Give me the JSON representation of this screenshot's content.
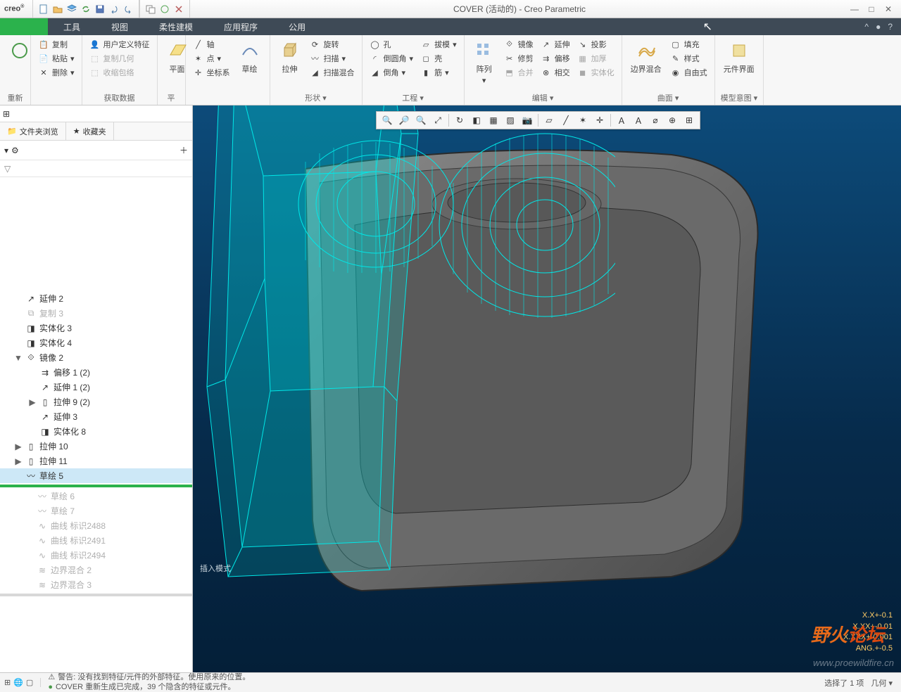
{
  "app": {
    "logo": "creo",
    "title": "COVER (活动的) - Creo Parametric"
  },
  "ribbon_tabs": [
    "工具",
    "视图",
    "柔性建模",
    "应用程序",
    "公用"
  ],
  "ribbon": {
    "clipboard": {
      "copy": "复制",
      "paste": "粘贴",
      "delete": "删除",
      "label": "重新"
    },
    "user": {
      "udf": "用户定义特征",
      "copygeom": "复制几何",
      "shrinkwrap": "收缩包络",
      "label": "获取数据"
    },
    "plane": {
      "plane": "平面",
      "label": "平"
    },
    "datum": {
      "axis": "轴",
      "point": "点",
      "csys": "坐标系",
      "sketch": "草绘"
    },
    "shape": {
      "extrude": "拉伸",
      "revolve": "旋转",
      "sweep": "扫描",
      "blend": "扫描混合",
      "label": "形状"
    },
    "eng": {
      "hole": "孔",
      "round": "倒圆角",
      "chamfer": "倒角",
      "draft": "拔模",
      "shell": "壳",
      "rib": "筋",
      "label": "工程"
    },
    "edit": {
      "pattern": "阵列",
      "mirror": "镜像",
      "trim": "修剪",
      "merge": "合并",
      "extend": "延伸",
      "offset": "偏移",
      "intersect": "相交",
      "project": "投影",
      "thicken": "加厚",
      "solidify": "实体化",
      "label": "编辑"
    },
    "surf": {
      "boundary": "边界混合",
      "fill": "填充",
      "style": "样式",
      "freestyle": "自由式",
      "label": "曲面"
    },
    "model": {
      "comp": "元件界面",
      "label": "模型意图"
    }
  },
  "side": {
    "tab_browser": "文件夹浏览",
    "tab_fav": "收藏夹",
    "items": [
      {
        "d": 0,
        "exp": "",
        "ic": "ext",
        "t": "延伸 2"
      },
      {
        "d": 0,
        "exp": "",
        "ic": "copy",
        "t": "复制 3",
        "dim": true
      },
      {
        "d": 0,
        "exp": "",
        "ic": "sol",
        "t": "实体化 3"
      },
      {
        "d": 0,
        "exp": "",
        "ic": "sol",
        "t": "实体化 4"
      },
      {
        "d": 0,
        "exp": "▼",
        "ic": "mir",
        "t": "镜像 2"
      },
      {
        "d": 1,
        "exp": "",
        "ic": "off",
        "t": "偏移 1 (2)"
      },
      {
        "d": 1,
        "exp": "",
        "ic": "ext",
        "t": "延伸 1 (2)"
      },
      {
        "d": 1,
        "exp": "▶",
        "ic": "extr",
        "t": "拉伸 9 (2)"
      },
      {
        "d": 1,
        "exp": "",
        "ic": "ext",
        "t": "延伸 3"
      },
      {
        "d": 1,
        "exp": "",
        "ic": "sol",
        "t": "实体化 8"
      },
      {
        "d": 0,
        "exp": "▶",
        "ic": "extr",
        "t": "拉伸 10"
      },
      {
        "d": 0,
        "exp": "▶",
        "ic": "extr",
        "t": "拉伸 11"
      },
      {
        "d": 0,
        "exp": "",
        "ic": "sk",
        "t": "草绘 5",
        "sel": true
      }
    ],
    "after": [
      {
        "ic": "sk",
        "t": "草绘 6"
      },
      {
        "ic": "sk",
        "t": "草绘 7"
      },
      {
        "ic": "crv",
        "t": "曲线 标识2488"
      },
      {
        "ic": "crv",
        "t": "曲线 标识2491"
      },
      {
        "ic": "crv",
        "t": "曲线 标识2494"
      },
      {
        "ic": "bnd",
        "t": "边界混合 2"
      },
      {
        "ic": "bnd",
        "t": "边界混合 3"
      }
    ]
  },
  "viewport": {
    "insert": "插入模式",
    "readout": [
      "X.X+-0.1",
      "X.XX+-0.01",
      "X.XXX+-0.001",
      "ANG.+-0.5"
    ],
    "watermark": "www.proewildfire.cn",
    "forum_a": "野火",
    "forum_b": "论坛"
  },
  "status": {
    "warn": "警告: 没有找到特征/元件的外部特征。使用原来的位置。",
    "info": "COVER 重新生成已完成，39 个隐含的特征或元件。",
    "sel": "选择了 1 项",
    "filter": "几何"
  }
}
